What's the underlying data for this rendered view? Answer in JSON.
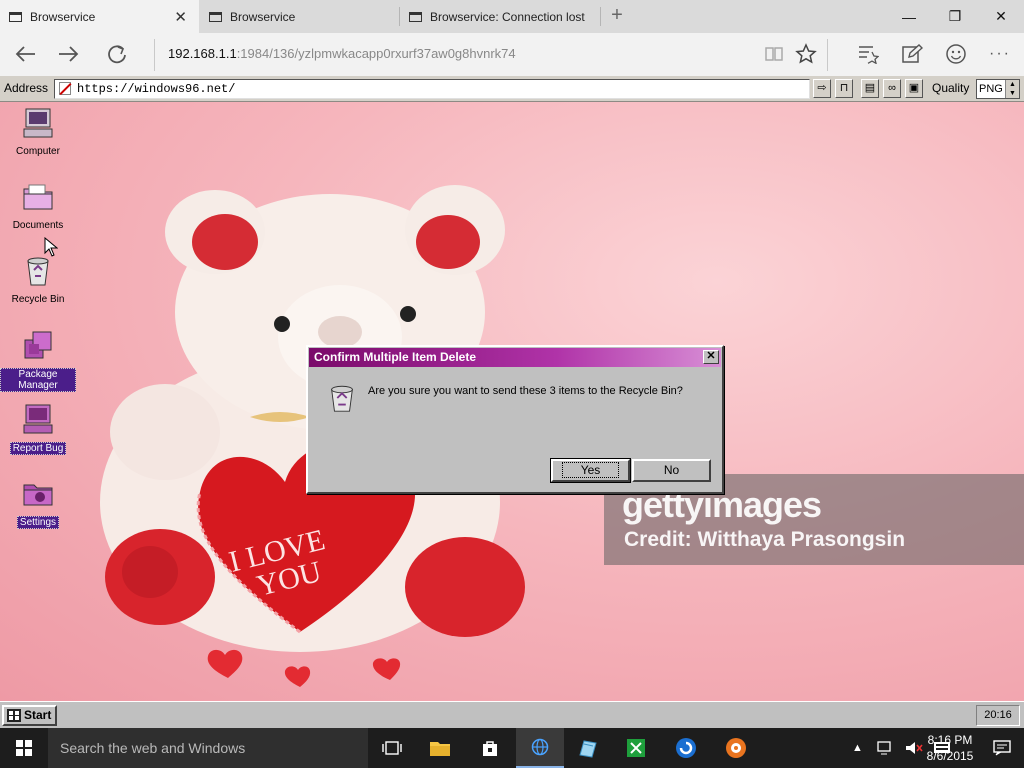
{
  "tabs": [
    {
      "title": "Browservice",
      "active": true
    },
    {
      "title": "Browservice",
      "active": false
    },
    {
      "title": "Browservice: Connection lost",
      "active": false
    }
  ],
  "window_controls": {
    "minimize": "—",
    "maximize": "❐",
    "close": "✕"
  },
  "edge_toolbar": {
    "url_host": "192.168.1.1",
    "url_path": ":1984/136/yzlpmwkacapp0rxurf37aw0g8hvnrk74"
  },
  "browservice_bar": {
    "address_label": "Address",
    "address_value": "https://windows96.net/",
    "quality_label": "Quality",
    "quality_value": "PNG"
  },
  "desktop_icons": [
    {
      "label": "Computer",
      "icon": "computer-icon",
      "selected": false
    },
    {
      "label": "Documents",
      "icon": "folder-icon",
      "selected": false
    },
    {
      "label": "Recycle Bin",
      "icon": "recycle-bin-icon",
      "selected": false
    },
    {
      "label": "Package Manager",
      "icon": "package-icon",
      "selected": true
    },
    {
      "label": "Report Bug",
      "icon": "bug-report-icon",
      "selected": true
    },
    {
      "label": "Settings",
      "icon": "settings-folder-icon",
      "selected": true
    }
  ],
  "wallpaper_text": {
    "heart_line1": "I LOVE",
    "heart_line2": "YOU",
    "getty_logo": "gettyimages",
    "getty_credit": "Credit: Witthaya Prasongsin"
  },
  "dialog": {
    "title": "Confirm Multiple Item Delete",
    "message": "Are you sure you want to send these 3 items to the Recycle Bin?",
    "yes_label": "Yes",
    "no_label": "No",
    "close_label": "✕"
  },
  "w96_taskbar": {
    "start_label": "Start",
    "clock": "20:16"
  },
  "w10_taskbar": {
    "search_placeholder": "Search the web and Windows",
    "time": "8:16 PM",
    "date": "8/6/2015"
  },
  "colors": {
    "dialog_title_start": "#7a0a6a",
    "dialog_title_end": "#d88fd6",
    "selection": "#4b1e8a",
    "win96_face": "#c0c0c0"
  }
}
